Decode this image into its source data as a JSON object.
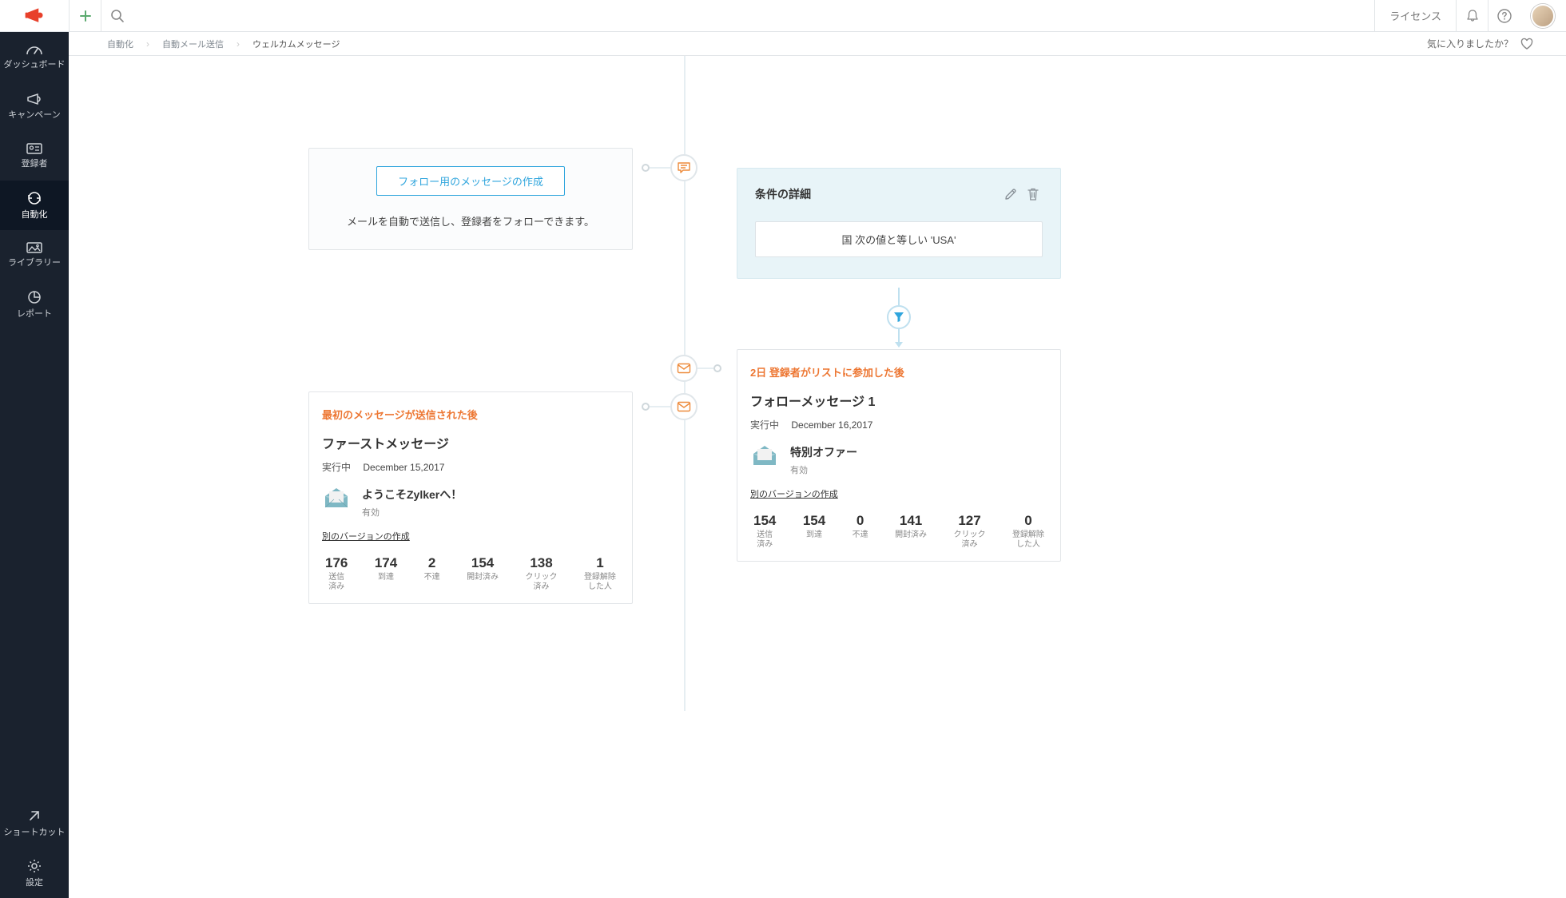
{
  "topbar": {
    "license": "ライセンス"
  },
  "sidebar": {
    "items": [
      {
        "label": "ダッシュボード"
      },
      {
        "label": "キャンペーン"
      },
      {
        "label": "登録者"
      },
      {
        "label": "自動化"
      },
      {
        "label": "ライブラリー"
      },
      {
        "label": "レポート"
      }
    ],
    "shortcut": "ショートカット",
    "settings": "設定"
  },
  "breadcrumb": {
    "items": [
      "自動化",
      "自動メール送信",
      "ウェルカムメッセージ"
    ],
    "liked_prompt": "気に入りましたか？"
  },
  "follow_create": {
    "button": "フォロー用のメッセージの作成",
    "desc": "メールを自動で送信し、登録者をフォローできます。"
  },
  "first_msg": {
    "trigger": "最初のメッセージが送信された後",
    "title": "ファーストメッセージ",
    "status": "実行中",
    "date": "December 15,2017",
    "subject": "ようこそZylkerへ！",
    "state": "有効",
    "version_link": "別のバージョンの作成",
    "stats": [
      {
        "num": "176",
        "label": "送信\n済み"
      },
      {
        "num": "174",
        "label": "到達"
      },
      {
        "num": "2",
        "label": "不達"
      },
      {
        "num": "154",
        "label": "開封済み"
      },
      {
        "num": "138",
        "label": "クリック\n済み"
      },
      {
        "num": "1",
        "label": "登録解除\nした人"
      }
    ]
  },
  "condition": {
    "title": "条件の詳細",
    "rule": "国 次の値と等しい 'USA'"
  },
  "follow_msg": {
    "trigger": "2日 登録者がリストに参加した後",
    "title": "フォローメッセージ 1",
    "status": "実行中",
    "date": "December 16,2017",
    "subject": "特別オファー",
    "state": "有効",
    "version_link": "別のバージョンの作成",
    "stats": [
      {
        "num": "154",
        "label": "送信\n済み"
      },
      {
        "num": "154",
        "label": "到達"
      },
      {
        "num": "0",
        "label": "不達"
      },
      {
        "num": "141",
        "label": "開封済み"
      },
      {
        "num": "127",
        "label": "クリック\n済み"
      },
      {
        "num": "0",
        "label": "登録解除\nした人"
      }
    ]
  }
}
